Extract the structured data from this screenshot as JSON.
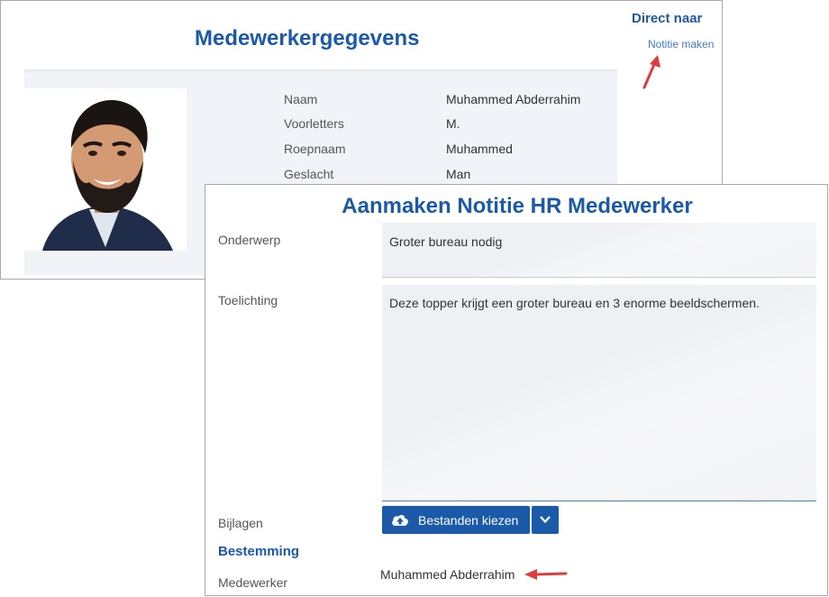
{
  "back_panel": {
    "title": "Medewerkergegevens",
    "direct_title": "Direct naar",
    "note_link": "Notitie maken",
    "fields": [
      {
        "label": "Naam",
        "value": "Muhammed Abderrahim"
      },
      {
        "label": "Voorletters",
        "value": "M."
      },
      {
        "label": "Roepnaam",
        "value": "Muhammed"
      },
      {
        "label": "Geslacht",
        "value": "Man"
      }
    ]
  },
  "form": {
    "title": "Aanmaken Notitie HR Medewerker",
    "subject_label": "Onderwerp",
    "subject_value": "Groter bureau nodig",
    "notes_label": "Toelichting",
    "notes_value": "Deze topper krijgt een groter bureau en 3 enorme beeldschermen.",
    "attachments_label": "Bijlagen",
    "upload_button": "Bestanden kiezen",
    "destination_heading": "Bestemming",
    "employee_label": "Medewerker",
    "employee_value": "Muhammed Abderrahim"
  },
  "colors": {
    "brand_blue": "#1a5aa8",
    "annotation_red": "#e03c3c"
  },
  "icons": {
    "upload": "cloud-upload-icon",
    "dropdown": "chevron-down-icon",
    "annotation": "red-arrow-icon"
  }
}
